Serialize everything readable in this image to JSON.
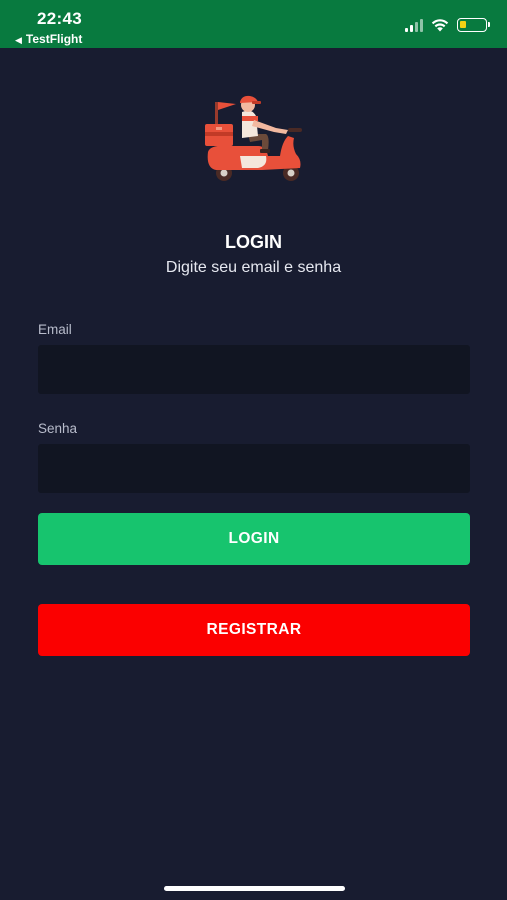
{
  "status_bar": {
    "time": "22:43",
    "back_label": "TestFlight",
    "back_icon": "back-triangle-icon",
    "background_color": "#087a3f"
  },
  "logo": {
    "icon": "delivery-scooter-icon",
    "primary_color": "#e8503a"
  },
  "header": {
    "title": "LOGIN",
    "subtitle": "Digite seu email e senha"
  },
  "form": {
    "email_label": "Email",
    "email_value": "",
    "password_label": "Senha",
    "password_value": ""
  },
  "buttons": {
    "login_label": "LOGIN",
    "login_color": "#17c46e",
    "register_label": "REGISTRAR",
    "register_color": "#fb0000"
  },
  "colors": {
    "background": "#181c30",
    "input_background": "#111522"
  }
}
